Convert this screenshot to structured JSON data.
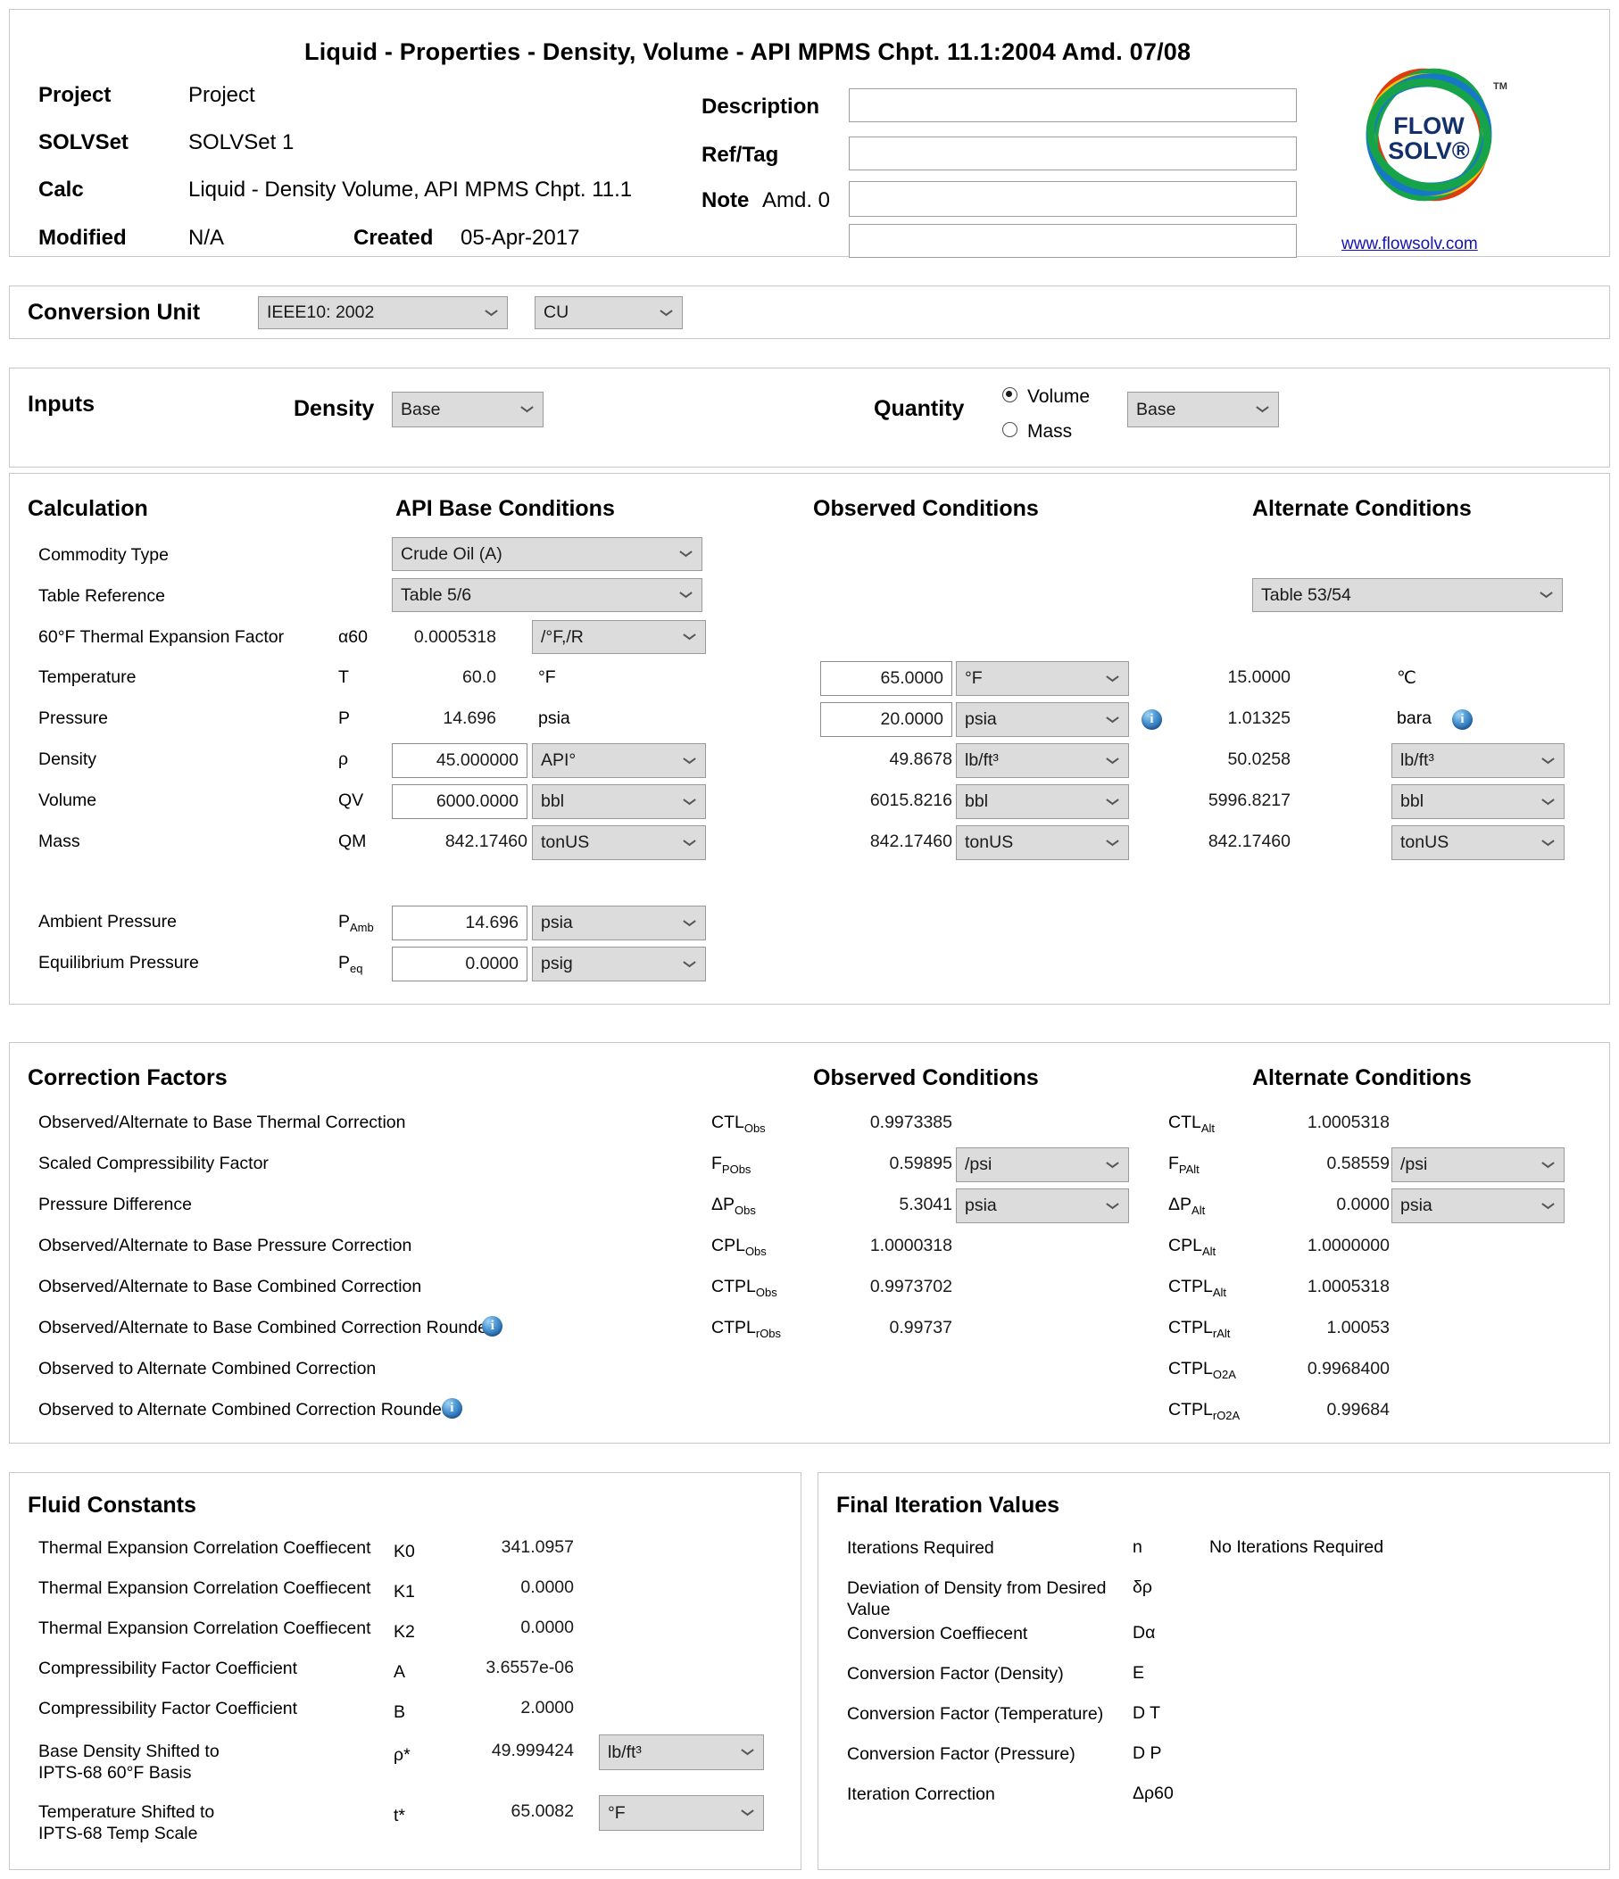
{
  "header": {
    "title": "Liquid - Properties - Density, Volume - API MPMS Chpt. 11.1:2004 Amd. 07/08",
    "fields": [
      {
        "label": "Project",
        "value": "Project"
      },
      {
        "label": "SOLVSet",
        "value": "SOLVSet 1"
      },
      {
        "label": "Calc",
        "value": "Liquid - Density Volume, API MPMS Chpt. 11.1"
      },
      {
        "label": "Modified",
        "value": "N/A"
      }
    ],
    "created_label": "Created",
    "created_value": "05-Apr-2017",
    "note_label": "Note",
    "note_value": "Amd. 0",
    "right_fields": [
      {
        "label": "Description",
        "value": ""
      },
      {
        "label": "Ref/Tag",
        "value": ""
      }
    ],
    "logo": {
      "line1": "FLOW",
      "line2": "SOLV®",
      "tm": "TM",
      "url": "www.flowsolv.com"
    }
  },
  "conversion_unit": {
    "label": "Conversion Unit",
    "standard": "IEEE10: 2002",
    "system": "CU"
  },
  "inputs": {
    "label": "Inputs",
    "density_label": "Density",
    "density_value": "Base",
    "quantity_label": "Quantity",
    "option_volume": "Volume",
    "option_mass": "Mass",
    "selected_quantity": "Volume",
    "quantity_value": "Base"
  },
  "calculation": {
    "title": "Calculation",
    "col_base": "API Base Conditions",
    "col_observed": "Observed Conditions",
    "col_alternate": "Alternate Conditions",
    "rows": {
      "commodity": {
        "label": "Commodity Type",
        "base": "Crude Oil (A)"
      },
      "table_ref": {
        "label": "Table Reference",
        "base": "Table 5/6",
        "alt": "Table 53/54"
      },
      "alpha60": {
        "label": "60°F Thermal Expansion Factor",
        "sym": "α60",
        "base_val": "0.0005318",
        "base_unit": "/°F,/R"
      },
      "temp": {
        "label": "Temperature",
        "sym": "T",
        "base_val": "60.0",
        "base_unit": "°F",
        "obs_val": "65.0000",
        "obs_unit": "°F",
        "alt_val": "15.0000",
        "alt_unit": "℃"
      },
      "press": {
        "label": "Pressure",
        "sym": "P",
        "base_val": "14.696",
        "base_unit": "psia",
        "obs_val": "20.0000",
        "obs_unit": "psia",
        "alt_val": "1.01325",
        "alt_unit": "bara"
      },
      "density": {
        "label": "Density",
        "sym": "ρ",
        "base_val": "45.000000",
        "base_unit": "API°",
        "obs_val": "49.8678",
        "obs_unit": "lb/ft³",
        "alt_val": "50.0258",
        "alt_unit": "lb/ft³"
      },
      "volume": {
        "label": "Volume",
        "sym": "QV",
        "base_val": "6000.0000",
        "base_unit": "bbl",
        "obs_val": "6015.8216",
        "obs_unit": "bbl",
        "alt_val": "5996.8217",
        "alt_unit": "bbl"
      },
      "mass": {
        "label": "Mass",
        "sym": "QM",
        "base_val": "842.17460",
        "base_unit": "tonUS",
        "obs_val": "842.17460",
        "obs_unit": "tonUS",
        "alt_val": "842.17460",
        "alt_unit": "tonUS"
      },
      "amb_press": {
        "label": "Ambient Pressure",
        "sym": "P",
        "sym_sub": "Amb",
        "base_val": "14.696",
        "base_unit": "psia"
      },
      "eq_press": {
        "label": "Equilibrium Pressure",
        "sym": "P",
        "sym_sub": "eq",
        "base_val": "0.0000",
        "base_unit": "psig"
      }
    }
  },
  "correction_factors": {
    "title": "Correction Factors",
    "col_observed": "Observed Conditions",
    "col_alternate": "Alternate Conditions",
    "rows": [
      {
        "label": "Observed/Alternate to Base Thermal Correction",
        "obs_sym": "CTL",
        "obs_sub": "Obs",
        "obs_val": "0.9973385",
        "alt_sym": "CTL",
        "alt_sub": "Alt",
        "alt_val": "1.0005318"
      },
      {
        "label": "Scaled Compressibility Factor",
        "obs_sym": "F",
        "obs_sub": "PObs",
        "obs_val": "0.59895",
        "obs_unit": "/psi",
        "alt_sym": "F",
        "alt_sub": "PAlt",
        "alt_val": "0.58559",
        "alt_unit": "/psi"
      },
      {
        "label": "Pressure Difference",
        "obs_sym": "ΔP",
        "obs_sub": "Obs",
        "obs_val": "5.3041",
        "obs_unit": "psia",
        "alt_sym": "ΔP",
        "alt_sub": "Alt",
        "alt_val": "0.0000",
        "alt_unit": "psia"
      },
      {
        "label": "Observed/Alternate to Base Pressure Correction",
        "obs_sym": "CPL",
        "obs_sub": "Obs",
        "obs_val": "1.0000318",
        "alt_sym": "CPL",
        "alt_sub": "Alt",
        "alt_val": "1.0000000"
      },
      {
        "label": "Observed/Alternate to Base Combined Correction",
        "obs_sym": "CTPL",
        "obs_sub": "Obs",
        "obs_val": "0.9973702",
        "alt_sym": "CTPL",
        "alt_sub": "Alt",
        "alt_val": "1.0005318"
      },
      {
        "label": "Observed/Alternate to Base Combined Correction Rounded",
        "has_info": true,
        "obs_sym": "CTPL",
        "obs_sub": "rObs",
        "obs_val": "0.99737",
        "alt_sym": "CTPL",
        "alt_sub": "rAlt",
        "alt_val": "1.00053"
      },
      {
        "label": "Observed to Alternate Combined Correction",
        "alt_sym": "CTPL",
        "alt_sub": "O2A",
        "alt_val": "0.9968400"
      },
      {
        "label": "Observed to Alternate Combined Correction Rounded",
        "has_info": true,
        "alt_sym": "CTPL",
        "alt_sub": "rO2A",
        "alt_val": "0.99684"
      }
    ]
  },
  "fluid_constants": {
    "title": "Fluid Constants",
    "rows": [
      {
        "label": "Thermal Expansion Correlation Coeffiecent",
        "sym": "K0",
        "value": "341.0957"
      },
      {
        "label": "Thermal Expansion Correlation Coeffiecent",
        "sym": "K1",
        "value": "0.0000"
      },
      {
        "label": "Thermal Expansion Correlation Coeffiecent",
        "sym": "K2",
        "value": "0.0000"
      },
      {
        "label": "Compressibility Factor Coefficient",
        "sym": "A",
        "value": "3.6557e-06"
      },
      {
        "label": "Compressibility Factor Coefficient",
        "sym": "B",
        "value": "2.0000"
      },
      {
        "label": "Base Density Shifted to\nIPTS-68 60°F Basis",
        "sym": "ρ*",
        "value": "49.999424",
        "unit": "lb/ft³"
      },
      {
        "label": "Temperature Shifted to\nIPTS-68 Temp Scale",
        "sym": "t*",
        "value": "65.0082",
        "unit": "°F"
      }
    ]
  },
  "final_iteration": {
    "title": "Final Iteration Values",
    "rows": [
      {
        "label": "Iterations Required",
        "sym": "n",
        "value": "No Iterations Required"
      },
      {
        "label": "Deviation of Density from Desired\nValue",
        "sym": "δρ",
        "value": ""
      },
      {
        "label": "Conversion Coeffiecent",
        "sym": "Dα",
        "value": ""
      },
      {
        "label": "Conversion Factor (Density)",
        "sym": "E",
        "value": ""
      },
      {
        "label": "Conversion Factor (Temperature)",
        "sym": "D T",
        "value": ""
      },
      {
        "label": "Conversion Factor (Pressure)",
        "sym": "D P",
        "value": ""
      },
      {
        "label": "Iteration Correction",
        "sym": "Δρ60",
        "value": ""
      }
    ]
  }
}
